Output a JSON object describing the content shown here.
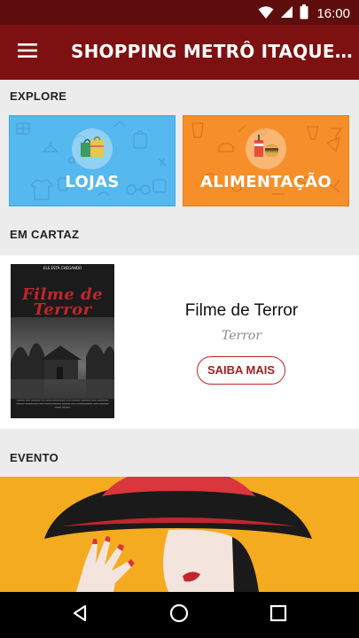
{
  "status_bar": {
    "time": "16:00",
    "icons": [
      "wifi-icon",
      "signal-icon",
      "battery-icon"
    ]
  },
  "app_bar": {
    "title": "SHOPPING METRÔ ITAQUE...",
    "menu_icon": "menu-icon"
  },
  "colors": {
    "app_bar": "#7d1111",
    "status_bar": "#5e0d0d",
    "lojas": "#55b8ee",
    "alimentacao": "#f68f2a",
    "accent": "#c0262c",
    "event": "#f5ab1f"
  },
  "explore": {
    "header": "EXPLORE",
    "cards": [
      {
        "label": "LOJAS",
        "icon": "shopping-bag-icon"
      },
      {
        "label": "ALIMENTAÇÃO",
        "icon": "burger-drink-icon"
      }
    ]
  },
  "em_cartaz": {
    "header": "EM CARTAZ",
    "movie": {
      "poster_tagline": "ELE ESTÁ CHEGANDO",
      "poster_title": "Filme de Terror",
      "title": "Filme de Terror",
      "genre": "Terror",
      "button": "SAIBA MAIS"
    }
  },
  "evento": {
    "header": "EVENTO"
  },
  "nav": {
    "icons": [
      "back-icon",
      "home-icon",
      "recents-icon"
    ]
  }
}
